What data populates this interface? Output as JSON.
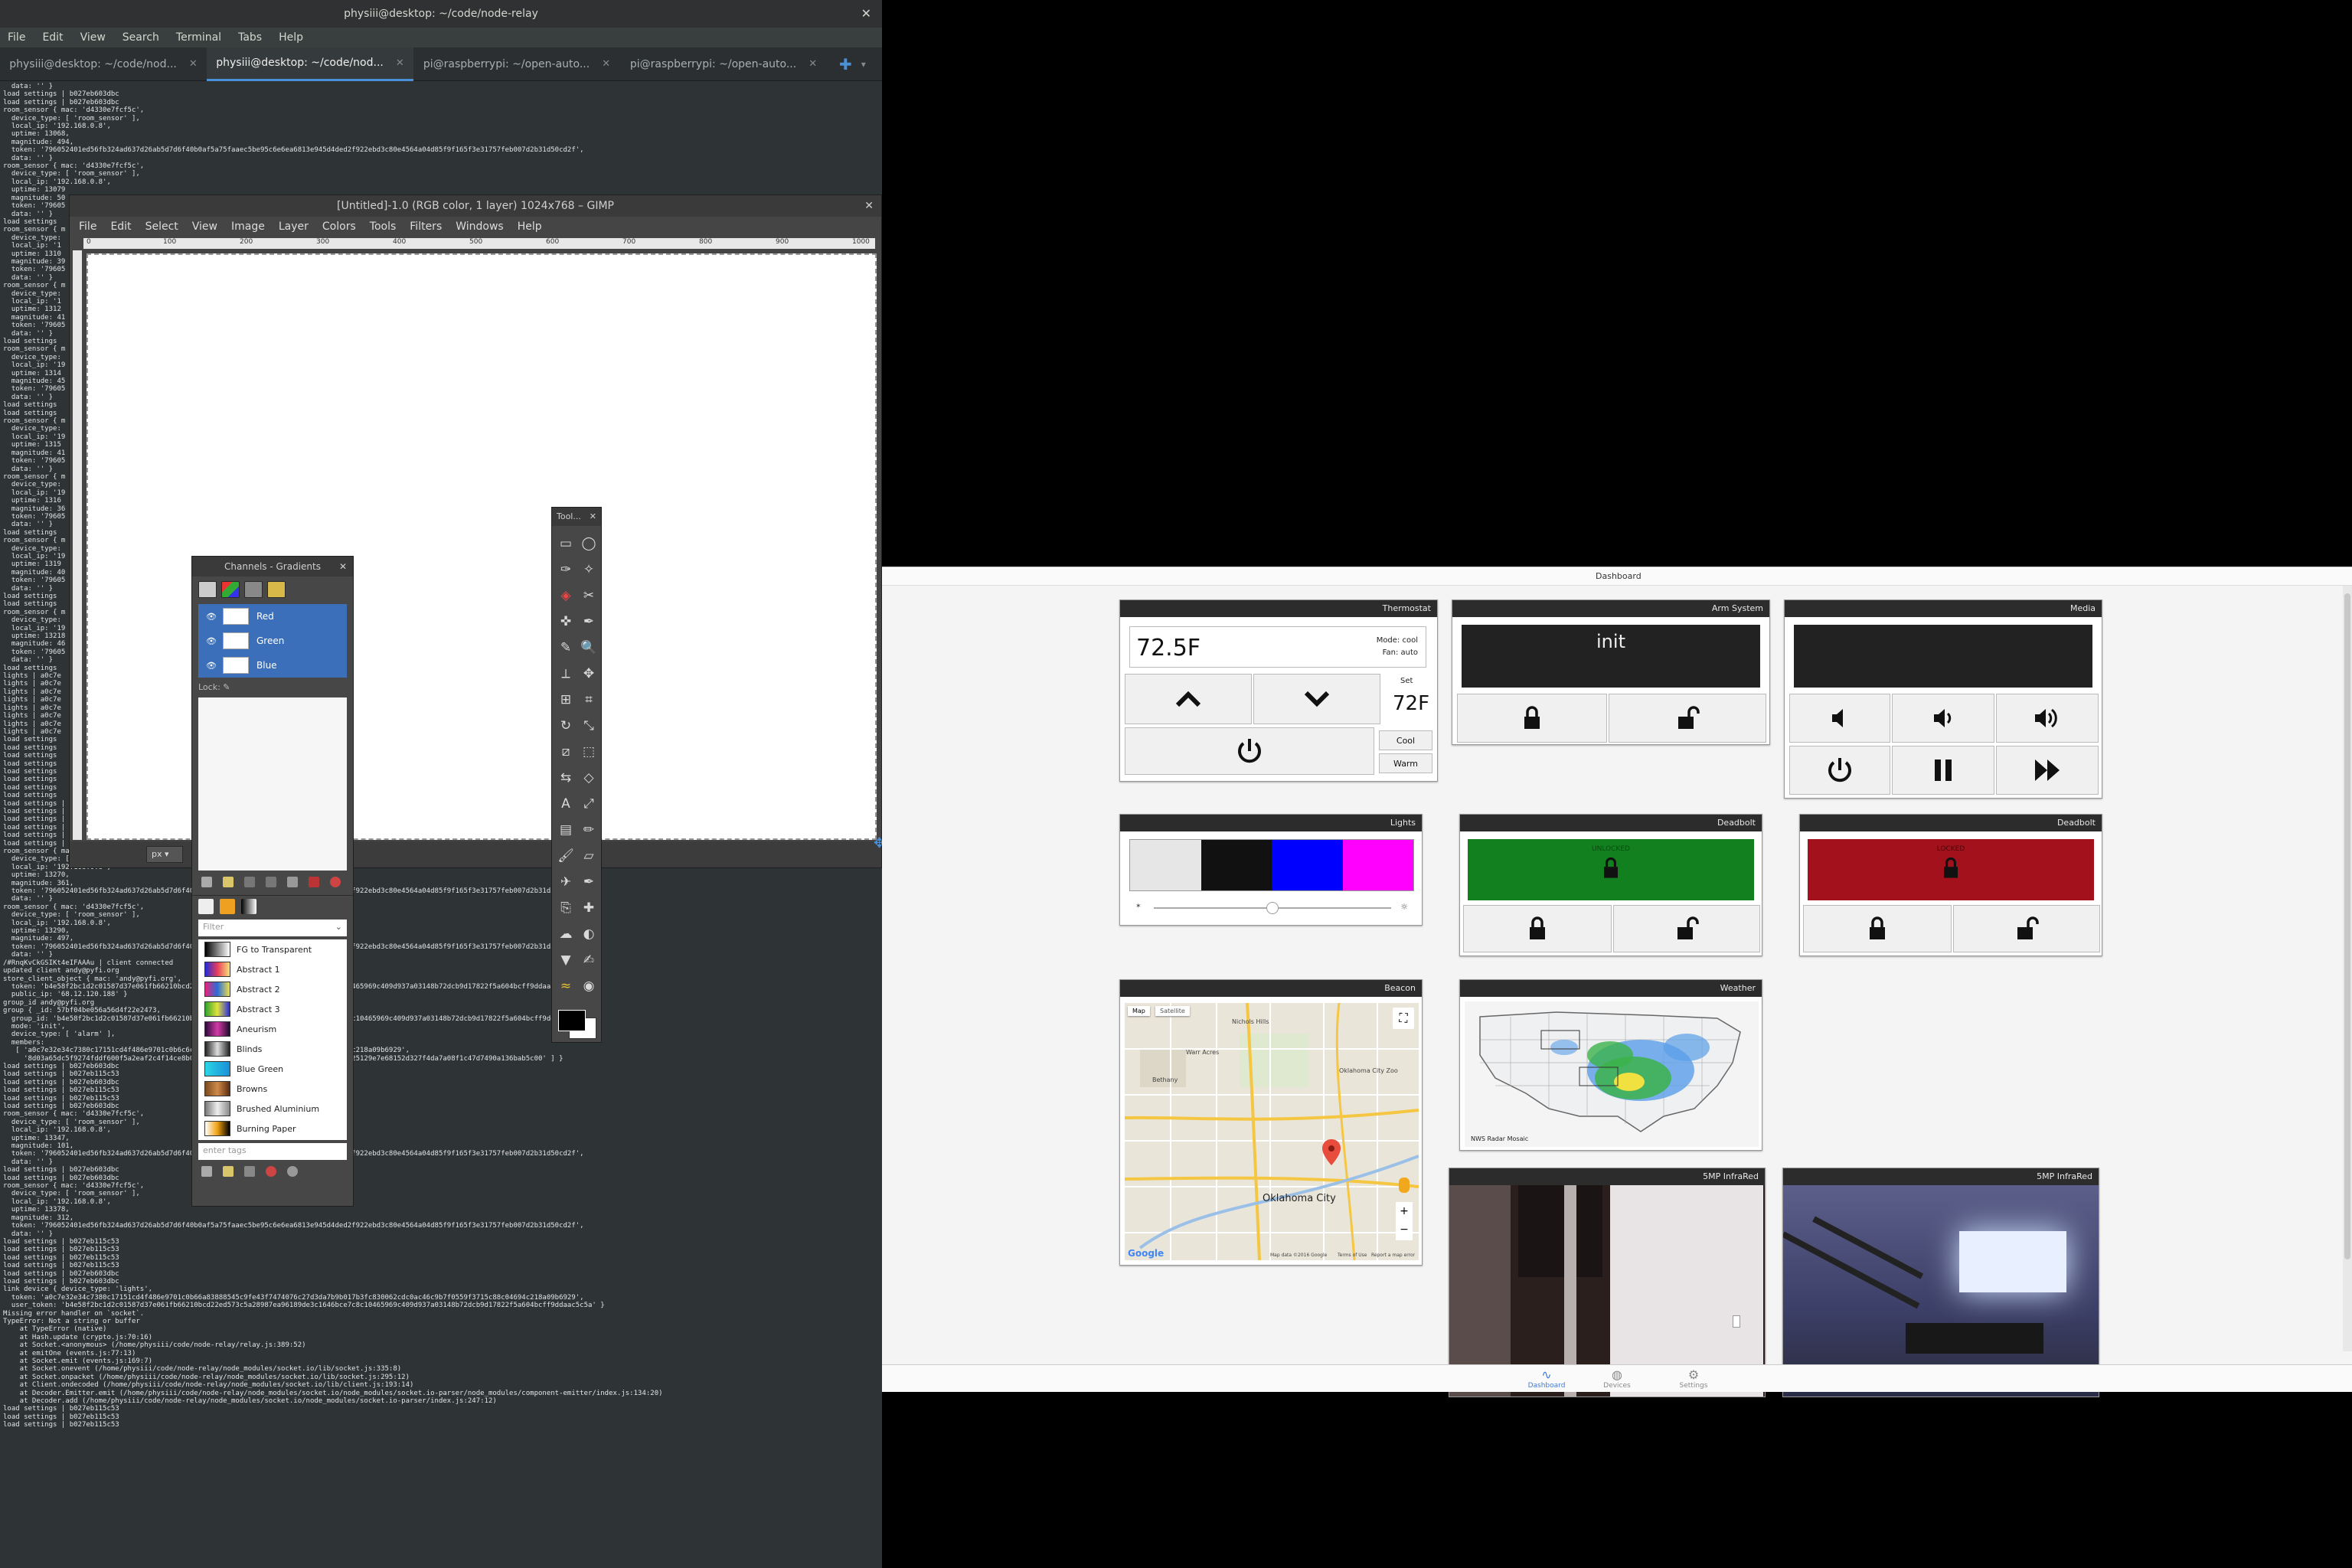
{
  "terminal": {
    "title": "physiii@desktop: ~/code/node-relay",
    "menu": [
      "File",
      "Edit",
      "View",
      "Search",
      "Terminal",
      "Tabs",
      "Help"
    ],
    "tabs": [
      {
        "label": "physiii@desktop: ~/code/nod...",
        "active": false
      },
      {
        "label": "physiii@desktop: ~/code/nod...",
        "active": true
      },
      {
        "label": "pi@raspberrypi: ~/open-auto...",
        "active": false
      },
      {
        "label": "pi@raspberrypi: ~/open-auto...",
        "active": false
      }
    ],
    "lines": [
      "  data: '' }",
      "load settings | b027eb603dbc",
      "load settings | b027eb603dbc",
      "room_sensor { mac: 'd4330e7fcf5c',",
      "  device_type: [ 'room_sensor' ],",
      "  local_ip: '192.168.0.8',",
      "  uptime: 13068,",
      "  magnitude: 494,",
      "  token: '796052401ed56fb324ad637d26ab5d7d6f40b0af5a75faaec5be95c6e6ea6813e945d4ded2f922ebd3c80e4564a04d85f9f165f3e31757feb007d2b31d50cd2f',",
      "  data: '' }",
      "room_sensor { mac: 'd4330e7fcf5c',",
      "  device_type: [ 'room_sensor' ],",
      "  local_ip: '192.168.0.8',",
      "  uptime: 13079",
      "  magnitude: 50",
      "  token: '79605",
      "  data: '' }",
      "load settings",
      "room_sensor { m",
      "  device_type:",
      "  local_ip: '1",
      "  uptime: 1310",
      "  magnitude: 39",
      "  token: '79605",
      "  data: '' }",
      "room_sensor { m",
      "  device_type:",
      "  local_ip: '1",
      "  uptime: 1312",
      "  magnitude: 41",
      "  token: '79605",
      "  data: '' }",
      "load settings",
      "room_sensor { m",
      "  device_type:",
      "  local_ip: '19",
      "  uptime: 1314",
      "  magnitude: 45",
      "  token: '79605",
      "  data: '' }",
      "load settings",
      "load settings",
      "room_sensor { m",
      "  device_type:",
      "  local_ip: '19",
      "  uptime: 1315",
      "  magnitude: 41",
      "  token: '79605",
      "  data: '' }",
      "room_sensor { m",
      "  device_type:",
      "  local_ip: '19",
      "  uptime: 1316",
      "  magnitude: 36",
      "  token: '79605",
      "  data: '' }",
      "load settings",
      "room_sensor { m",
      "  device_type:",
      "  local_ip: '19",
      "  uptime: 1319",
      "  magnitude: 40",
      "  token: '79605",
      "  data: '' }",
      "load settings",
      "load settings",
      "room_sensor { m",
      "  device_type:",
      "  local_ip: '19",
      "  uptime: 13218",
      "  magnitude: 46",
      "  token: '79605",
      "  data: '' }",
      "load settings",
      "lights | a0c7e",
      "lights | a0c7e",
      "lights | a0c7e",
      "lights | a0c7e",
      "lights | a0c7e",
      "lights | a0c7e",
      "lights | a0c7e",
      "lights | a0c7e",
      "load settings",
      "load settings",
      "load settings",
      "load settings",
      "load settings",
      "load settings",
      "load settings",
      "load settings",
      "load settings | b027eb115c53",
      "load settings | b027eb115c53",
      "load settings | b027eb115c53",
      "load settings | b027eb115c53",
      "load settings | b027eb115c53",
      "load settings | b027eb115c53",
      "room_sensor { mac: 'd4330e7fcf5c',",
      "  device_type: [ 'room_sensor' ],",
      "  local_ip: '192.168.0.8',",
      "  uptime: 13270,",
      "  magnitude: 361,",
      "  token: '796052401ed56fb324ad637d26ab5d7d6f40b0af5a75faaec5be95c6e6ea6813e945d4ded2f922ebd3c80e4564a04d85f9f165f3e31757feb007d2b31d50cd2f',",
      "  data: '' }",
      "room_sensor { mac: 'd4330e7fcf5c',",
      "  device_type: [ 'room_sensor' ],",
      "  local_ip: '192.168.0.8',",
      "  uptime: 13290,",
      "  magnitude: 497,",
      "  token: '796052401ed56fb324ad637d26ab5d7d6f40b0af5a75faaec5be95c6e6ea6813e945d4ded2f922ebd3c80e4564a04d85f9f165f3e31757feb007d2b31d50cd2f',",
      "  data: '' }",
      "/#RnqKvCkGSIKt4eIFAAAu | client connected",
      "updated client andy@pyfi.org",
      "store_client_object { mac: 'andy@pyfi.org',",
      "  token: 'b4e58f2bc1d2c01587d37e061fb66210bcd22ed573c5a28987ea96189de3c1646bce7c8c10465969c409d937a03148b72dcb9d17822f5a604bcff9ddaac5c5a',",
      "  public_ip: '68.12.120.188' }",
      "group_id andy@pyfi.org",
      "group { _id: 57bf04be056a56d4f22e2473,",
      "  group_id: 'b4e58f2bc1d2c01587d37e061fb66210bcd22ed573c5a28987ea96189de3c1646bce7c8c10465969c409d937a03148b72dcb9d17822f5a604bcff9ddaac5c5a',",
      "  mode: 'init',",
      "  device_type: [ 'alarm' ],",
      "  members:",
      "   [ 'a0c7e32e34c7380c17151cd4f486e9701c0b6c6c8c30062cdc0ac46c9b7f0559f3715c88c04694c218a09b6929',",
      "     '8d03a65dc5f9274fddf600f5a2eaf2c4f14ce8b0c68e9e73a6a9a6d37e6b66b4fa4b541a5d533625129e7e68152d327f4da7a08f1c47d7490a136bab5c00' ] }",
      "load settings | b027eb603dbc",
      "load settings | b027eb115c53",
      "load settings | b027eb603dbc",
      "load settings | b027eb115c53",
      "load settings | b027eb115c53",
      "load settings | b027eb603dbc",
      "room_sensor { mac: 'd4330e7fcf5c',",
      "  device_type: [ 'room_sensor' ],",
      "  local_ip: '192.168.0.8',",
      "  uptime: 13347,",
      "  magnitude: 101,",
      "  token: '796052401ed56fb324ad637d26ab5d7d6f40b0af5a75faaec5be95c6e6ea6813e945d4ded2f922ebd3c80e4564a04d85f9f165f3e31757feb007d2b31d50cd2f',",
      "  data: '' }",
      "load settings | b027eb603dbc",
      "load settings | b027eb603dbc",
      "room_sensor { mac: 'd4330e7fcf5c',",
      "  device_type: [ 'room_sensor' ],",
      "  local_ip: '192.168.0.8',",
      "  uptime: 13378,",
      "  magnitude: 312,",
      "  token: '796052401ed56fb324ad637d26ab5d7d6f40b0af5a75faaec5be95c6e6ea6813e945d4ded2f922ebd3c80e4564a04d85f9f165f3e31757feb007d2b31d50cd2f',",
      "  data: '' }",
      "load settings | b027eb115c53",
      "load settings | b027eb115c53",
      "load settings | b027eb115c53",
      "load settings | b027eb115c53",
      "load settings | b027eb603dbc",
      "load settings | b027eb603dbc",
      "link device { device_type: 'lights',",
      "  token: 'a0c7e32e34c7380c17151cd4f486e9701c0b66a83888545c9fe43f7474076c27d3da7b9b017b3fc830062cdc0ac46c9b7f0559f3715c88c04694c218a09b6929',",
      "  user_token: 'b4e58f2bc1d2c01587d37e061fb66210bcd22ed573c5a28987ea96189de3c1646bce7c8c10465969c409d937a03148b72dcb9d17822f5a604bcff9ddaac5c5a' }",
      "Missing error handler on `socket`.",
      "TypeError: Not a string or buffer",
      "    at TypeError (native)",
      "    at Hash.update (crypto.js:70:16)",
      "    at Socket.<anonymous> (/home/physiii/code/node-relay/relay.js:389:52)",
      "    at emitOne (events.js:77:13)",
      "    at Socket.emit (events.js:169:7)",
      "    at Socket.onevent (/home/physiii/code/node-relay/node_modules/socket.io/lib/socket.js:335:8)",
      "    at Socket.onpacket (/home/physiii/code/node-relay/node_modules/socket.io/lib/socket.js:295:12)",
      "    at Client.ondecoded (/home/physiii/code/node-relay/node_modules/socket.io/lib/client.js:193:14)",
      "    at Decoder.Emitter.emit (/home/physiii/code/node-relay/node_modules/socket.io/node_modules/socket.io-parser/node_modules/component-emitter/index.js:134:20)",
      "    at Decoder.add (/home/physiii/code/node-relay/node_modules/socket.io/node_modules/socket.io-parser/index.js:247:12)",
      "load settings | b027eb115c53",
      "load settings | b027eb115c53",
      "load settings | b027eb115c53"
    ]
  },
  "gimp": {
    "title": "[Untitled]-1.0 (RGB color, 1 layer) 1024x768 – GIMP",
    "menu": [
      "File",
      "Edit",
      "Select",
      "View",
      "Image",
      "Layer",
      "Colors",
      "Tools",
      "Filters",
      "Windows",
      "Help"
    ],
    "ruler_labels": [
      "0",
      "100",
      "200",
      "300",
      "400",
      "500",
      "600",
      "700",
      "800",
      "900",
      "1000"
    ],
    "unit": "px"
  },
  "dock": {
    "title": "Channels - Gradients",
    "channels": [
      "Red",
      "Green",
      "Blue"
    ],
    "lock_label": "Lock:",
    "filter_placeholder": "Filter",
    "tags_placeholder": "enter tags",
    "gradients": [
      {
        "name": "FG to Transparent",
        "colors": [
          "#000000",
          "#ffffff"
        ]
      },
      {
        "name": "Abstract 1",
        "colors": [
          "#1e2bd8",
          "#e83d5c",
          "#f6e27a"
        ]
      },
      {
        "name": "Abstract 2",
        "colors": [
          "#e7247a",
          "#2a6dd8",
          "#f1e04a"
        ]
      },
      {
        "name": "Abstract 3",
        "colors": [
          "#2fa12e",
          "#e2e43a",
          "#2a2ae0"
        ]
      },
      {
        "name": "Aneurism",
        "colors": [
          "#2a0a3a",
          "#d43aa8",
          "#1d0a2d"
        ]
      },
      {
        "name": "Blinds",
        "colors": [
          "#222222",
          "#dddddd",
          "#222222"
        ]
      },
      {
        "name": "Blue Green",
        "colors": [
          "#2ad6e6",
          "#1a8fd8"
        ]
      },
      {
        "name": "Browns",
        "colors": [
          "#7a4a1d",
          "#d08a4a",
          "#5a2c10"
        ]
      },
      {
        "name": "Brushed Aluminium",
        "colors": [
          "#777777",
          "#eeeeee",
          "#888888"
        ]
      },
      {
        "name": "Burning Paper",
        "colors": [
          "#ffffff",
          "#f0a010",
          "#000000"
        ]
      }
    ]
  },
  "toolbox": {
    "title": "Tool...",
    "tools": [
      "rect-select",
      "ellipse-select",
      "free-select",
      "fuzzy-select",
      "select-by-color",
      "scissors",
      "foreground-select",
      "paths",
      "color-picker",
      "zoom",
      "measure",
      "move",
      "align",
      "crop",
      "rotate",
      "scale",
      "shear",
      "perspective",
      "flip",
      "cage",
      "text",
      "unified-transform",
      "blend",
      "pencil",
      "paintbrush",
      "eraser",
      "airbrush",
      "ink",
      "clone",
      "heal",
      "smudge",
      "dodge",
      "bucket-fill",
      "mypaint-brush",
      "warp",
      "blur"
    ]
  },
  "dashboard": {
    "title": "Dashboard",
    "thermostat": {
      "title": "Thermostat",
      "current": "72.5F",
      "mode": "Mode: cool",
      "fan": "Fan: auto",
      "set_label": "Set",
      "set": "72F",
      "cool": "Cool",
      "warm": "Warm"
    },
    "arm": {
      "title": "Arm System",
      "status": "init"
    },
    "media": {
      "title": "Media"
    },
    "lights": {
      "title": "Lights",
      "colors": [
        "#e6e6e6",
        "#111111",
        "#0000ff",
        "#ff00ff"
      ],
      "brightness": 0.5
    },
    "deadbolt1": {
      "title": "Deadbolt",
      "status": "UNLOCKED",
      "color": "#12801f"
    },
    "deadbolt2": {
      "title": "Deadbolt",
      "status": "LOCKED",
      "color": "#a3121c"
    },
    "beacon": {
      "title": "Beacon",
      "map_tab": "Map",
      "sat_tab": "Satellite",
      "city": "Oklahoma City",
      "places": [
        "Nichols Hills",
        "Oklahoma City Zoo",
        "Bethany",
        "Warr Acres"
      ],
      "credit": "Map data ©2016 Google",
      "terms": "Terms of Use",
      "report": "Report a map error",
      "logo": "Google"
    },
    "weather": {
      "title": "Weather",
      "credit": "NWS Radar Mosaic"
    },
    "cam1": {
      "title": "5MP InfraRed"
    },
    "cam2": {
      "title": "5MP InfraRed"
    },
    "footer": [
      {
        "label": "Dashboard",
        "icon": "pulse-icon",
        "active": true
      },
      {
        "label": "Devices",
        "icon": "globe-icon",
        "active": false
      },
      {
        "label": "Settings",
        "icon": "gear-icon",
        "active": false
      }
    ]
  }
}
